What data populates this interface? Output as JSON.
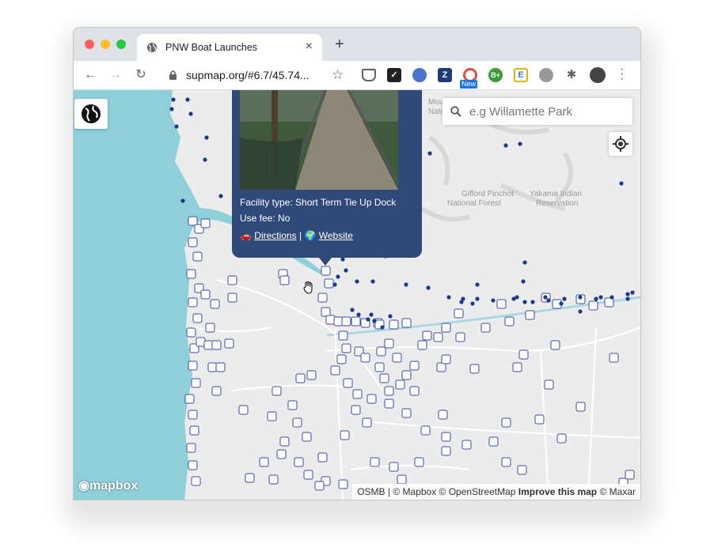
{
  "browser": {
    "tab_title": "PNW Boat Launches",
    "url": "supmap.org/#6.7/45.74...",
    "new_tab": "+",
    "tab_close": "×",
    "extensions": [
      {
        "name": "pocket-icon",
        "label": "",
        "color": "#5f6368"
      },
      {
        "name": "todo-icon",
        "label": "✓",
        "color": "#222222"
      },
      {
        "name": "feather-icon",
        "label": "",
        "color": "#4a74c9"
      },
      {
        "name": "zotero-icon",
        "label": "Z",
        "color": "#1f3b7a"
      },
      {
        "name": "chrome-ext-icon",
        "label": "",
        "color": "#dd4b39"
      },
      {
        "name": "bplus-icon",
        "label": "B+",
        "color": "#3a9b3a"
      },
      {
        "name": "e-icon",
        "label": "E",
        "color": "#e0b400"
      },
      {
        "name": "robot-icon",
        "label": "",
        "color": "#888888"
      },
      {
        "name": "puzzle-icon",
        "label": "",
        "color": "#5f6368"
      },
      {
        "name": "avatar-icon",
        "label": "",
        "color": "#444444"
      }
    ],
    "new_badge": "New"
  },
  "search": {
    "placeholder": "e.g Willamette Park"
  },
  "popup": {
    "facility_type": "Facility type: Short Term Tie Up Dock",
    "use_fee": "Use fee: No",
    "directions": "Directions",
    "separator": "|",
    "website": "Website"
  },
  "map_labels": {
    "gifford": "Gifford Pinchot",
    "national_forest": "National Forest",
    "yakama": "Yakama Indian",
    "reservation": "Reservation",
    "mount": "Mou",
    "natl": "Nati"
  },
  "map_logo": "mapbox",
  "attribution": {
    "text": "OSMB | © Mapbox © OpenStreetMap ",
    "improve": "Improve this map",
    "maxar": " © Maxar"
  },
  "colors": {
    "water": "#8ecfd9",
    "land": "#ececec",
    "popup": "#2f4a78",
    "marker": "#3c4aa8",
    "dot": "#1a3a8f"
  }
}
